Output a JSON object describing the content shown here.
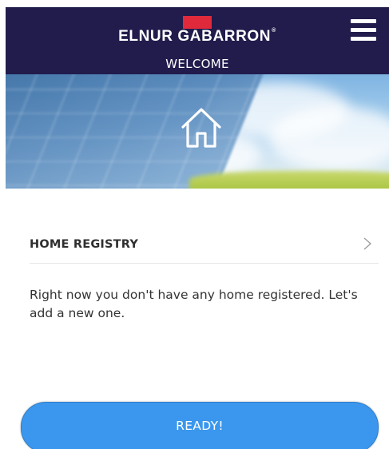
{
  "header": {
    "brand_name": "ELNUR GABARRON",
    "brand_registered_mark": "®",
    "brand_color": "#e02a3c",
    "background_color": "#211c4c",
    "subtitle": "WELCOME",
    "menu_icon": "hamburger-menu-icon"
  },
  "banner": {
    "icon": "home-icon",
    "description_scene": "solar-panels-sky"
  },
  "home_registry": {
    "title": "HOME REGISTRY",
    "chevron_icon": "chevron-right-icon",
    "message": "Right now you don't have any home registered. Let's add a new one."
  },
  "actions": {
    "ready_label": "READY!",
    "ready_color": "#3a97ed"
  }
}
